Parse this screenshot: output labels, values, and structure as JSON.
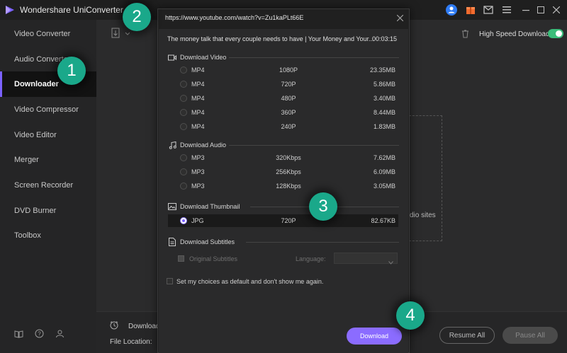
{
  "app": {
    "title": "Wondershare UniConverter",
    "accent_color": "#7b61ff",
    "badge_color": "#1aa88a"
  },
  "titlebar": {
    "icons": [
      "user-icon",
      "gift-icon",
      "mail-icon",
      "menu-icon"
    ],
    "controls": [
      "minimize-icon",
      "maximize-icon",
      "close-icon"
    ]
  },
  "sidebar": {
    "items": [
      {
        "label": "Video Converter"
      },
      {
        "label": "Audio Converter"
      },
      {
        "label": "Downloader",
        "active": true
      },
      {
        "label": "Video Compressor"
      },
      {
        "label": "Video Editor"
      },
      {
        "label": "Merger"
      },
      {
        "label": "Screen Recorder"
      },
      {
        "label": "DVD Burner"
      },
      {
        "label": "Toolbox"
      }
    ],
    "bottom_icons": [
      "book-icon",
      "help-icon",
      "account-icon"
    ]
  },
  "main": {
    "high_speed_label": "High Speed Download",
    "high_speed_on": true,
    "drop_text": "dio sites",
    "download_label": "Download",
    "file_location_label": "File Location:",
    "resume_all": "Resume All",
    "pause_all": "Pause All"
  },
  "dialog": {
    "url": "https://www.youtube.com/watch?v=Zu1kaPLt66E",
    "video_title": "The money talk that every couple needs to have | Your Money and Your...",
    "duration": "00:03:15",
    "video_section": {
      "heading": "Download Video",
      "rows": [
        {
          "format": "MP4",
          "quality": "1080P",
          "size": "23.35MB"
        },
        {
          "format": "MP4",
          "quality": "720P",
          "size": "5.86MB"
        },
        {
          "format": "MP4",
          "quality": "480P",
          "size": "3.40MB"
        },
        {
          "format": "MP4",
          "quality": "360P",
          "size": "8.44MB"
        },
        {
          "format": "MP4",
          "quality": "240P",
          "size": "1.83MB"
        }
      ]
    },
    "audio_section": {
      "heading": "Download Audio",
      "rows": [
        {
          "format": "MP3",
          "quality": "320Kbps",
          "size": "7.62MB"
        },
        {
          "format": "MP3",
          "quality": "256Kbps",
          "size": "6.09MB"
        },
        {
          "format": "MP3",
          "quality": "128Kbps",
          "size": "3.05MB"
        }
      ]
    },
    "thumbnail_section": {
      "heading": "Download Thumbnail",
      "rows": [
        {
          "format": "JPG",
          "quality": "720P",
          "size": "82.67KB",
          "selected": true
        }
      ]
    },
    "subtitles_section": {
      "heading": "Download Subtitles",
      "original_subtitles_label": "Original Subtitles",
      "language_label": "Language:"
    },
    "default_choice_label": "Set my choices as default and don't show me again.",
    "download_button": "Download"
  },
  "badges": [
    "1",
    "2",
    "3",
    "4"
  ]
}
